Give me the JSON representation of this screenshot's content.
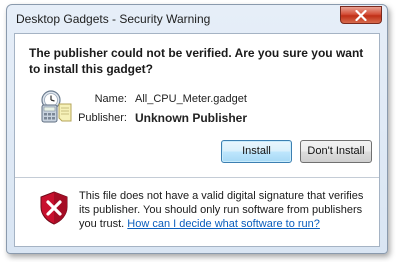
{
  "window": {
    "title": "Desktop Gadgets - Security Warning"
  },
  "dialog": {
    "question": "The publisher could not be verified. Are you sure you want to install this gadget?",
    "fields": {
      "name_label": "Name:",
      "name_value": "All_CPU_Meter.gadget",
      "publisher_label": "Publisher:",
      "publisher_value": "Unknown Publisher"
    },
    "buttons": {
      "install": "Install",
      "dont_install": "Don't Install"
    },
    "warning": {
      "text": "This file does not have a valid digital signature that verifies its publisher. You should only run software from publishers you trust. ",
      "link": "How can I decide what software to run?"
    }
  },
  "icons": {
    "gadget": "gadget-icon",
    "shield": "security-shield-icon",
    "close": "close-icon"
  },
  "colors": {
    "link": "#0b5ebd",
    "close_button": "#c9402a",
    "shield_red": "#c8102e"
  }
}
